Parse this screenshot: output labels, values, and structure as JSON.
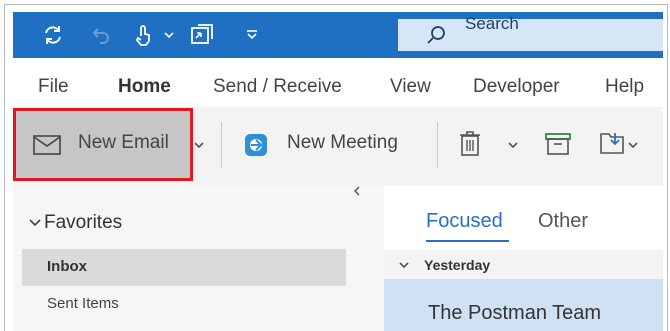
{
  "titlebar": {
    "search_label": "Search",
    "background": "#1f6fc2"
  },
  "quick_access": {
    "icons": [
      "sync-icon",
      "undo-icon",
      "touch-mode-icon",
      "dropdown-caret-icon",
      "folder-switch-icon",
      "customize-toolbar-icon"
    ]
  },
  "menu": {
    "tabs": [
      "File",
      "Home",
      "Send / Receive",
      "View",
      "Developer",
      "Help"
    ]
  },
  "ribbon": {
    "new_email_label": "New Email",
    "new_meeting_label": "New Meeting",
    "highlight_color": "#e0191e"
  },
  "folders": {
    "favorites_label": "Favorites",
    "items": [
      "Inbox",
      "Sent Items"
    ]
  },
  "message_list": {
    "tabs": [
      "Focused",
      "Other"
    ],
    "group_label": "Yesterday",
    "messages": [
      {
        "sender": "The Postman Team"
      }
    ],
    "accent": "#2c6fc0"
  }
}
